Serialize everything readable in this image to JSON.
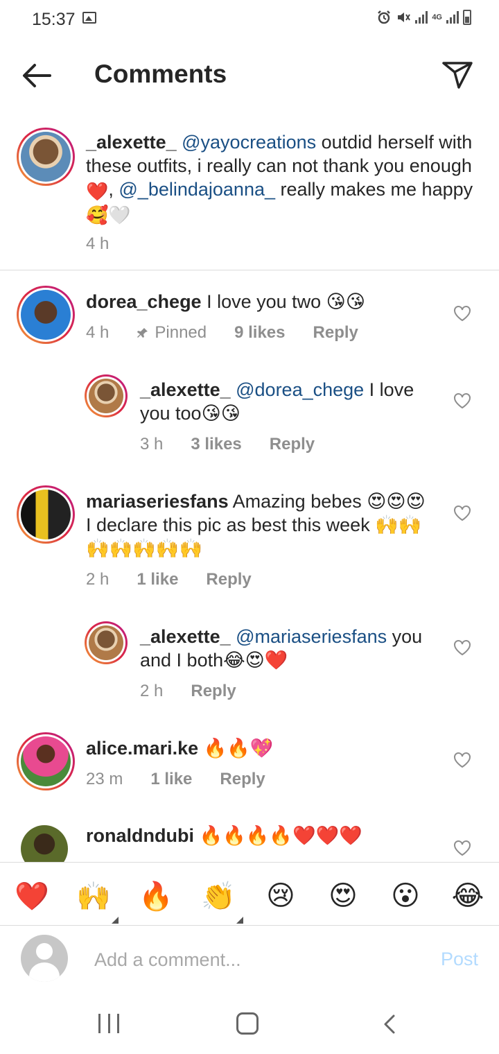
{
  "status_bar": {
    "time": "15:37",
    "network": "4G"
  },
  "header": {
    "title": "Comments"
  },
  "caption": {
    "username": "_alexette_",
    "segments": [
      {
        "text": "@yayocreations",
        "mention": true
      },
      {
        "text": " outdid herself with these outfits, i really can not thank you enough ",
        "mention": false
      },
      {
        "text": "❤️",
        "mention": false
      },
      {
        "text": ", ",
        "mention": false
      },
      {
        "text": "@_belindajoanna_",
        "mention": true
      },
      {
        "text": " really makes me happy ",
        "mention": false
      },
      {
        "text": "🥰🤍",
        "mention": false
      }
    ],
    "time": "4 h"
  },
  "comments": [
    {
      "username": "dorea_chege",
      "text": "I love you two 😘😘",
      "time": "4 h",
      "pinned": "Pinned",
      "likes": "9 likes",
      "reply": "Reply",
      "avatar_color": "#2a7fd4"
    },
    {
      "username": "_alexette_",
      "mention": "@dorea_chege",
      "text": " I love you too😘😘",
      "time": "3 h",
      "likes": "3 likes",
      "reply": "Reply",
      "avatar_color": "#b07a48"
    },
    {
      "username": "mariaseriesfans",
      "text": "Amazing bebes 😍😍😍 I declare this pic as best this week 🙌🙌🙌🙌🙌🙌🙌",
      "time": "2 h",
      "likes": "1 like",
      "reply": "Reply",
      "avatar_color": "#1d1d1d"
    },
    {
      "username": "_alexette_",
      "mention": "@mariaseriesfans",
      "text": " you and I both😂😍❤️",
      "time": "2 h",
      "reply": "Reply",
      "avatar_color": "#b07a48"
    },
    {
      "username": "alice.mari.ke",
      "text": "🔥🔥💖",
      "time": "23 m",
      "likes": "1 like",
      "reply": "Reply",
      "avatar_color": "#d94a8c"
    },
    {
      "username": "ronaldndubi",
      "text": "🔥🔥🔥🔥❤️❤️❤️",
      "avatar_color": "#4a5a2a"
    }
  ],
  "quick_emojis": [
    {
      "name": "heart",
      "char": "❤️"
    },
    {
      "name": "raising-hands",
      "char": "🙌"
    },
    {
      "name": "fire",
      "char": "🔥"
    },
    {
      "name": "clapping-hands",
      "char": "👏"
    },
    {
      "name": "crying-face",
      "char": "😢"
    },
    {
      "name": "heart-eyes",
      "char": "😍"
    },
    {
      "name": "surprised-face",
      "char": "😮"
    },
    {
      "name": "tears-of-joy",
      "char": "😂"
    }
  ],
  "composer": {
    "placeholder": "Add a comment...",
    "post_label": "Post"
  },
  "colors": {
    "mention": "#1a4f84",
    "post_disabled": "#b3dbff",
    "meta": "#8e8e8e"
  }
}
